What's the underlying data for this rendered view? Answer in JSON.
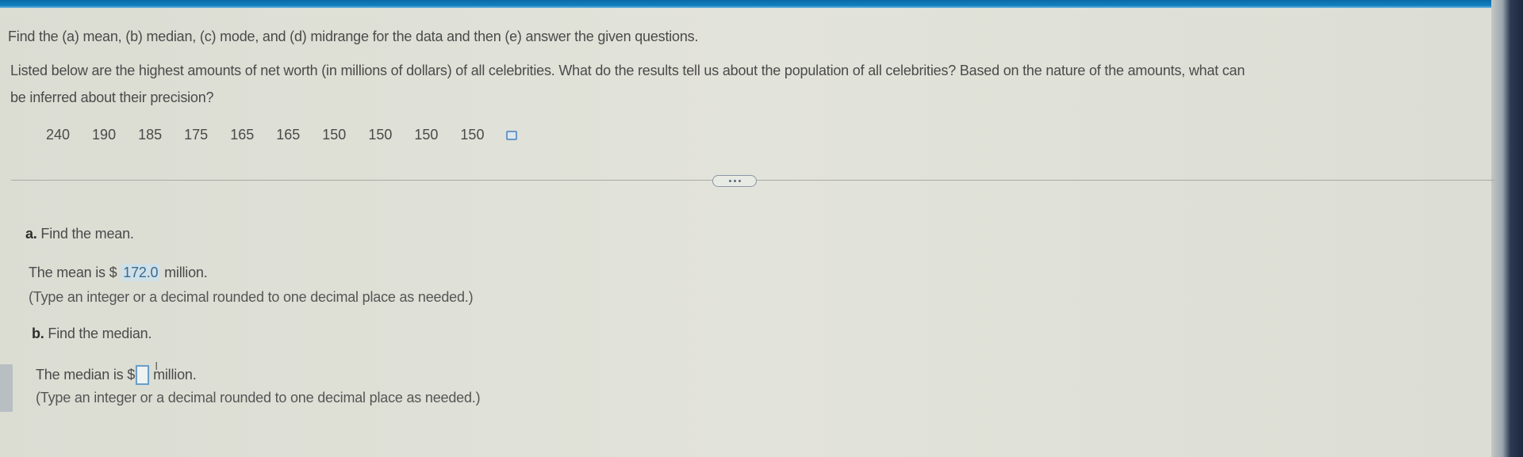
{
  "header": {
    "instruction": "Find the (a) mean, (b) median, (c) mode, and (d) midrange for the data and then (e) answer the given questions."
  },
  "question": {
    "line1": "Listed below are the highest amounts of net worth (in millions of dollars) of all celebrities. What do the results tell us about the population of all celebrities? Based on the nature of the amounts, what can",
    "line2": "be inferred about their precision?"
  },
  "dataset": {
    "values": [
      "240",
      "190",
      "185",
      "175",
      "165",
      "165",
      "150",
      "150",
      "150",
      "150"
    ],
    "copy_icon": "copy-data-icon"
  },
  "more_button": {
    "icon": "ellipsis-icon"
  },
  "part_a": {
    "letter": "a.",
    "prompt": " Find the mean.",
    "answer_prefix": "The mean is $ ",
    "answer_value": "172.0",
    "answer_suffix": " million.",
    "hint": "(Type an integer or a decimal rounded to one decimal place as needed.)"
  },
  "part_b": {
    "letter": "b.",
    "prompt": " Find the median.",
    "answer_prefix": "The median is $",
    "answer_value": "",
    "answer_suffix": "million.",
    "hint": "(Type an integer or a decimal rounded to one decimal place as needed.)"
  }
}
